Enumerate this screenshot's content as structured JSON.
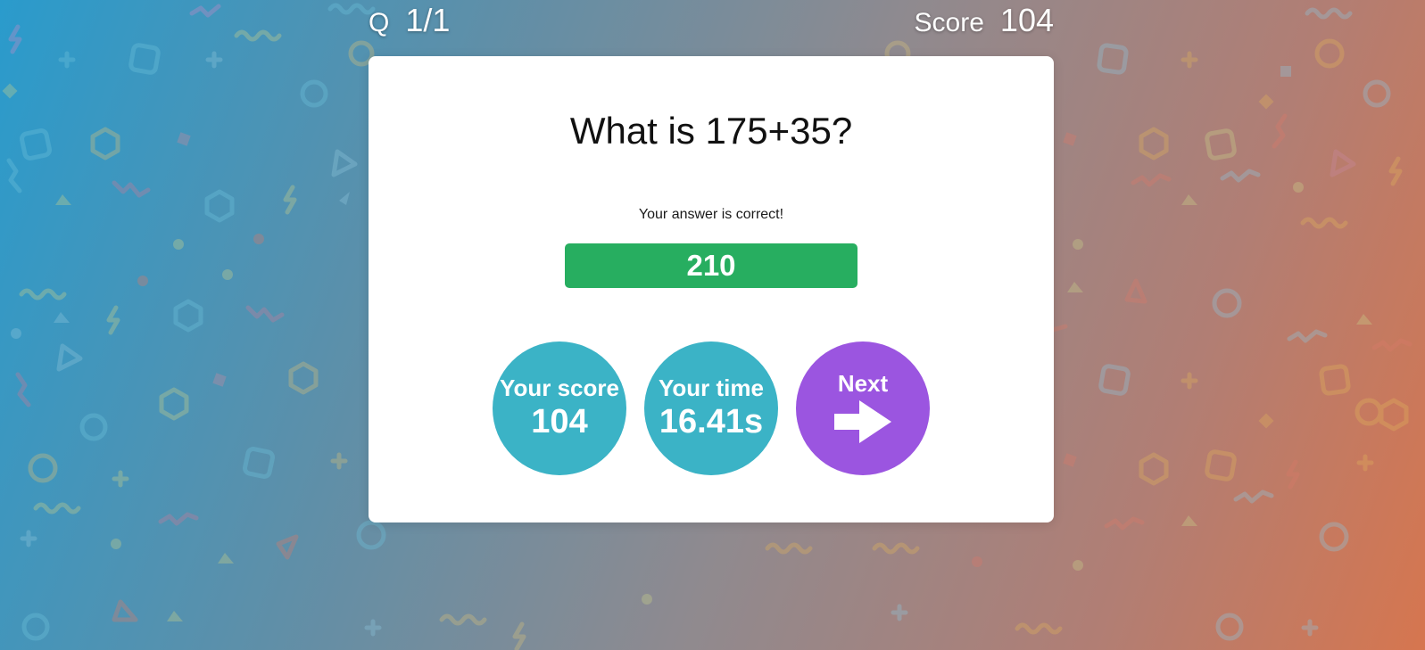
{
  "hud": {
    "question_label": "Q",
    "question_value": "1/1",
    "score_label": "Score",
    "score_value": "104"
  },
  "card": {
    "question": "What is 175+35?",
    "feedback": "Your answer is correct!",
    "answer": "210",
    "score_label": "Your score",
    "score_value": "104",
    "time_label": "Your time",
    "time_value": "16.41s",
    "next_label": "Next"
  },
  "colors": {
    "correct": "#27ae60",
    "stat_circle": "#3bb3c6",
    "next_button": "#9b55e0",
    "background_left": "#2a9bcc",
    "background_right": "#d6764f"
  },
  "icons": {
    "next": "arrow-right-icon"
  }
}
